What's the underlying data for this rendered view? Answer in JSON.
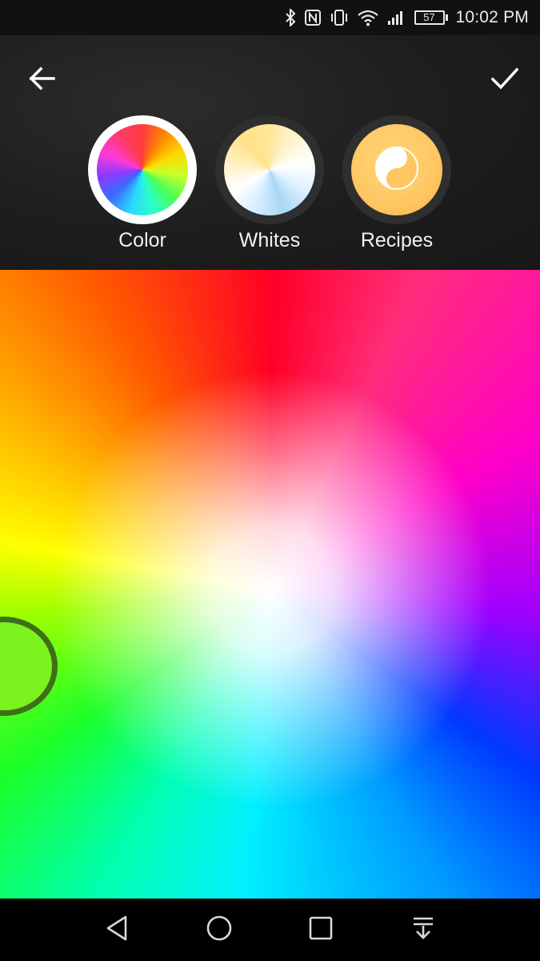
{
  "status_bar": {
    "time": "10:02 PM",
    "battery_level": "57",
    "icons": [
      "bluetooth-icon",
      "nfc-icon",
      "vibrate-icon",
      "wifi-icon",
      "cellular-signal-icon",
      "battery-icon"
    ]
  },
  "header": {
    "back_icon": "arrow-left-icon",
    "confirm_icon": "checkmark-icon",
    "tabs": [
      {
        "label": "Color",
        "selected": true,
        "icon": "color-wheel-icon"
      },
      {
        "label": "Whites",
        "selected": false,
        "icon": "whites-wheel-icon"
      },
      {
        "label": "Recipes",
        "selected": false,
        "icon": "recipes-icon"
      }
    ]
  },
  "color_picker": {
    "selected_color": "#7cf21e",
    "handle_border_color": "#3f6f1a"
  },
  "nav_bar": {
    "icons": [
      "back-triangle-icon",
      "home-circle-icon",
      "recents-square-icon",
      "notification-pull-down-icon"
    ]
  }
}
